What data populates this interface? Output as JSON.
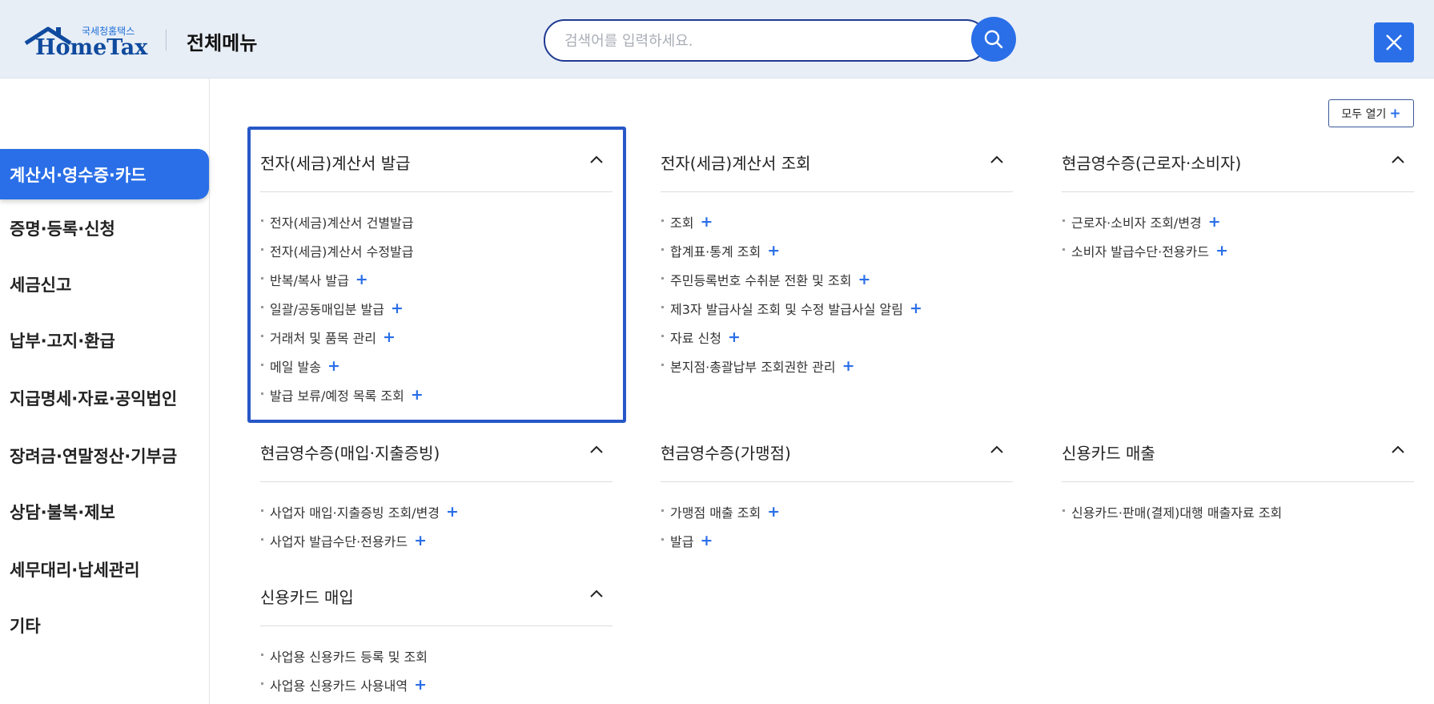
{
  "header": {
    "logo_small": "국세청홈택스",
    "logo_main": "HomeTax",
    "title": "전체메뉴",
    "search_placeholder": "검색어를 입력하세요."
  },
  "open_all_label": "모두 열기",
  "sidebar": {
    "items": [
      {
        "label": "계산서·영수증·카드",
        "active": true
      },
      {
        "label": "증명·등록·신청"
      },
      {
        "label": "세금신고"
      },
      {
        "label": "납부·고지·환급"
      },
      {
        "label": "지급명세·자료·공익법인"
      },
      {
        "label": "장려금·연말정산·기부금"
      },
      {
        "label": "상담·불복·제보"
      },
      {
        "label": "세무대리·납세관리"
      },
      {
        "label": "기타"
      }
    ]
  },
  "sections": [
    {
      "title": "전자(세금)계산서 발급",
      "items": [
        {
          "label": "전자(세금)계산서 건별발급",
          "plus": false
        },
        {
          "label": "전자(세금)계산서 수정발급",
          "plus": false
        },
        {
          "label": "반복/복사 발급",
          "plus": true
        },
        {
          "label": "일괄/공동매입분 발급",
          "plus": true
        },
        {
          "label": "거래처 및 품목 관리",
          "plus": true
        },
        {
          "label": "메일 발송",
          "plus": true
        },
        {
          "label": "발급 보류/예정 목록 조회",
          "plus": true
        }
      ]
    },
    {
      "title": "전자(세금)계산서 조회",
      "items": [
        {
          "label": "조회",
          "plus": true
        },
        {
          "label": "합계표·통계 조회",
          "plus": true
        },
        {
          "label": "주민등록번호 수취분 전환 및 조회",
          "plus": true
        },
        {
          "label": "제3자 발급사실 조회 및 수정 발급사실 알림",
          "plus": true
        },
        {
          "label": "자료 신청",
          "plus": true
        },
        {
          "label": "본지점·총괄납부 조회권한 관리",
          "plus": true
        }
      ]
    },
    {
      "title": "현금영수증(근로자·소비자)",
      "items": [
        {
          "label": "근로자·소비자 조회/변경",
          "plus": true
        },
        {
          "label": "소비자 발급수단·전용카드",
          "plus": true
        }
      ]
    },
    {
      "title": "현금영수증(매입·지출증빙)",
      "items": [
        {
          "label": "사업자 매입·지출증빙 조회/변경",
          "plus": true
        },
        {
          "label": "사업자 발급수단·전용카드",
          "plus": true
        }
      ]
    },
    {
      "title": "현금영수증(가맹점)",
      "items": [
        {
          "label": "가맹점 매출 조회",
          "plus": true
        },
        {
          "label": "발급",
          "plus": true
        }
      ]
    },
    {
      "title": "신용카드 매출",
      "items": [
        {
          "label": "신용카드·판매(결제)대행 매출자료 조회",
          "plus": false
        }
      ]
    },
    {
      "title": "신용카드 매입",
      "items": [
        {
          "label": "사업용 신용카드 등록 및 조회",
          "plus": false
        },
        {
          "label": "사업용 신용카드 사용내역",
          "plus": true
        }
      ]
    }
  ],
  "colors": {
    "accent": "#2a6fe8",
    "header_bg": "#e8eef6",
    "highlight_border": "#2757c7"
  }
}
